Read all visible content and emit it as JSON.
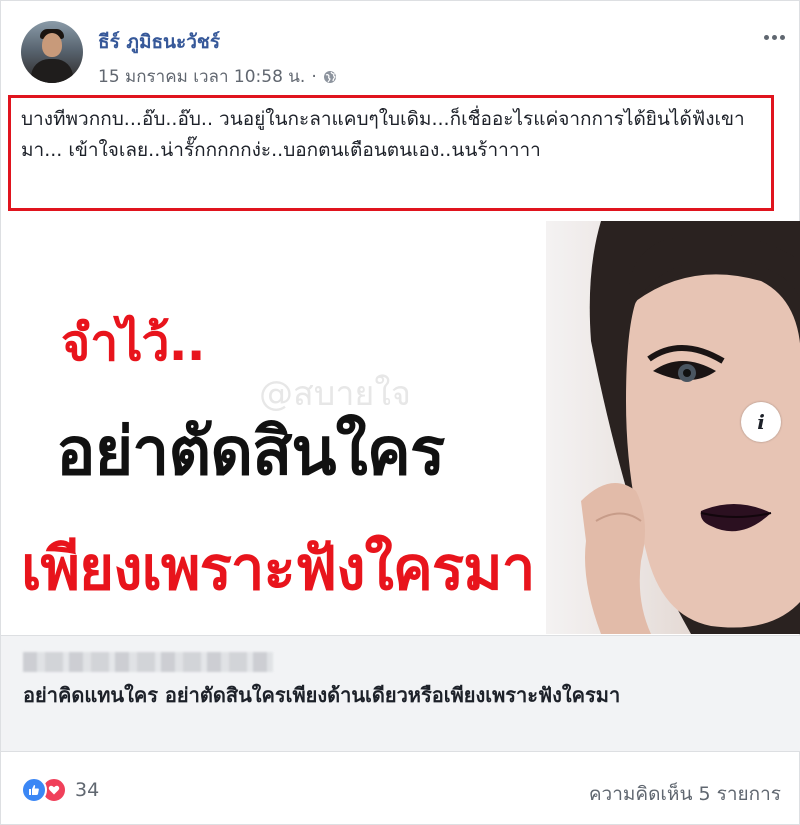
{
  "post": {
    "author": "ธีร์ ภูมิธนะวัชร์",
    "timestamp": "15 มกราคม เวลา 10:58 น.",
    "separator": "·",
    "privacy_icon": "globe-icon",
    "more_icon": "more-options-icon",
    "text": "บางทีพวกกบ...อ๊บ..อ๊บ.. วนอยู่ในกะลาแคบๆใบเดิม...ก็เชื่ออะไรแค่จากการได้ยินได้ฟังเขามา... เข้าใจเลย..น่ารั๊กกกกกง่ะ..บอกตนเตือนตนเอง..นนร้าาาาา",
    "highlight_color": "#e0141e"
  },
  "preview_image": {
    "line1": "จำไว้..",
    "line2": "อย่าตัดสินใคร",
    "line3": "เพียงเพราะฟังใครมา",
    "watermark": "@สบายใจ",
    "info_label": "i",
    "accent_red": "#e8141c"
  },
  "link": {
    "title": "อย่าคิดแทนใคร อย่าตัดสินใครเพียงด้านเดียวหรือเพียงเพราะฟังใครมา"
  },
  "footer": {
    "reaction_icons": [
      "like-icon",
      "love-icon"
    ],
    "reaction_count": "34",
    "comments": "ความคิดเห็น 5 รายการ"
  }
}
